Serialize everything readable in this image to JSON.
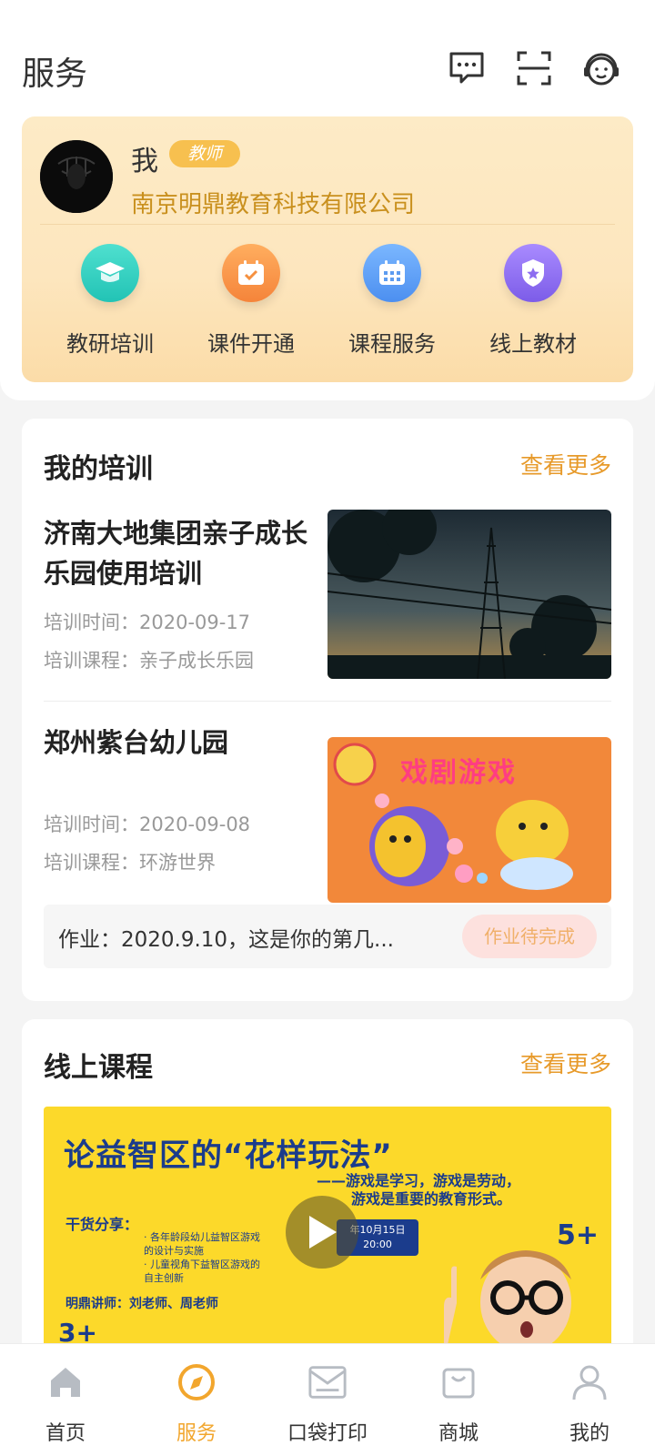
{
  "header": {
    "title": "服务",
    "icons": [
      "message-icon",
      "scan-icon",
      "customer-service-icon"
    ]
  },
  "profile": {
    "name": "我",
    "role": "教师",
    "organization": "南京明鼎教育科技有限公司",
    "actions": [
      {
        "label": "教研培训",
        "icon": "graduation-cap-icon",
        "color": "#2fcfc0"
      },
      {
        "label": "课件开通",
        "icon": "calendar-check-icon",
        "color": "#f5963f"
      },
      {
        "label": "课程服务",
        "icon": "calendar-grid-icon",
        "color": "#5da2f6"
      },
      {
        "label": "线上教材",
        "icon": "shield-star-icon",
        "color": "#8c6cf0"
      }
    ]
  },
  "training": {
    "title": "我的培训",
    "more": "查看更多",
    "items": [
      {
        "title": "济南大地集团亲子成长乐园使用培训",
        "time": "培训时间：2020-09-17",
        "course": "培训课程：亲子成长乐园"
      },
      {
        "title": "郑州紫台幼儿园",
        "time": "培训时间：2020-09-08",
        "course": "培训课程：环游世界"
      }
    ],
    "item2_image_text": "戏剧游戏",
    "homework": {
      "text": "作业：2020.9.10，这是你的第几...",
      "status": "作业待完成"
    }
  },
  "online_course": {
    "title": "线上课程",
    "more": "查看更多",
    "banner": {
      "title": "论益智区的“花样玩法”",
      "tagline1": "——游戏是学习，游戏是劳动，",
      "tagline2": "游戏是重要的教育形式。",
      "share": "干货分享：",
      "point1": "· 各年龄段幼儿益智区游戏",
      "point1b": "的设计与实施",
      "point2": "· 儿童视角下益智区游戏的",
      "point2b": "自主创新",
      "teacher": "明鼎讲师：刘老师、周老师",
      "date1": "年10月15日",
      "date2": "20:00",
      "age_right": "5+",
      "age_left": "3+"
    }
  },
  "tabs": [
    {
      "label": "首页",
      "icon": "home-icon",
      "active": false
    },
    {
      "label": "服务",
      "icon": "compass-icon",
      "active": true
    },
    {
      "label": "口袋打印",
      "icon": "printer-icon",
      "active": false
    },
    {
      "label": "商城",
      "icon": "shopping-bag-icon",
      "active": false
    },
    {
      "label": "我的",
      "icon": "user-icon",
      "active": false
    }
  ],
  "colors": {
    "accent": "#f2a62d",
    "more": "#e79a2a",
    "org": "#c9901e",
    "card_bg": "#fde6be"
  }
}
